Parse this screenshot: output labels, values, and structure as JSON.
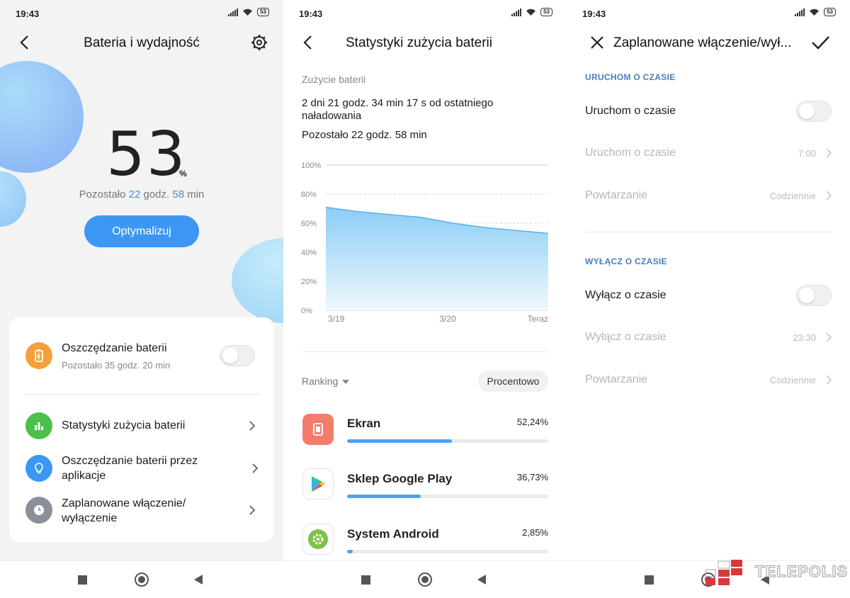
{
  "status": {
    "time": "19:43",
    "battery": "53"
  },
  "p1": {
    "title": "Bateria i wydajność",
    "percent": "53",
    "percent_sign": "%",
    "remaining_prefix": "Pozostało",
    "remaining_hours": "22",
    "remaining_hours_unit": "godz.",
    "remaining_minutes": "58",
    "remaining_minutes_unit": "min",
    "optimize_label": "Optymalizuj",
    "saver_title": "Oszczędzanie baterii",
    "saver_sub": "Pozostało 35 godz. 20 min",
    "stats_label": "Statystyki zużycia baterii",
    "apps_label_1": "Oszczędzanie baterii przez",
    "apps_label_2": "aplikacje",
    "sched_label_1": "Zaplanowane włączenie/",
    "sched_label_2": "wyłączenie",
    "colors": {
      "accent": "#3b97f2",
      "saver": "#f4a03a",
      "stats": "#4cc04a",
      "apps": "#3b97f2",
      "sched": "#8a8f9a"
    }
  },
  "p2": {
    "title": "Statystyki zużycia baterii",
    "usage_label": "Zużycie baterii",
    "since_1": "2 dni 21 godz. 34 min 17 s od ostatniego",
    "since_2": "naładowania",
    "remaining": "Pozostało 22 godz. 58 min",
    "ranking_label": "Ranking",
    "percent_pill": "Procentowo",
    "apps": [
      {
        "name": "Ekran",
        "percent_label": "52,24%",
        "fraction": 0.5224,
        "icon": "screen-icon"
      },
      {
        "name": "Sklep Google Play",
        "percent_label": "36,73%",
        "fraction": 0.3673,
        "icon": "play-store-icon"
      },
      {
        "name": "System Android",
        "percent_label": "2,85%",
        "fraction": 0.0285,
        "icon": "android-system-icon"
      }
    ]
  },
  "chart_data": {
    "type": "area",
    "x": [
      "3/19",
      "3/19",
      "3/19",
      "3/19",
      "3/20",
      "3/20",
      "3/20",
      "Teraz"
    ],
    "series": [
      {
        "values": [
          71,
          68,
          66,
          64,
          60,
          57,
          55,
          53
        ]
      }
    ],
    "y_tick_labels": [
      "100%",
      "80%",
      "60%",
      "40%",
      "20%",
      "0%"
    ],
    "x_tick_labels": [
      "3/19",
      "3/20",
      "Teraz"
    ],
    "ylim": [
      0,
      100
    ],
    "grid": true
  },
  "p3": {
    "title": "Zaplanowane włączenie/wył...",
    "section_on": "URUCHOM O CZASIE",
    "on_toggle_label": "Uruchom o czasie",
    "on_time_label": "Uruchom o czasie",
    "on_time_value": "7:00",
    "on_repeat_label": "Powtarzanie",
    "on_repeat_value": "Codziennie",
    "section_off": "WYŁĄCZ O CZASIE",
    "off_toggle_label": "Wyłącz o czasie",
    "off_time_label": "Wyłącz o czasie",
    "off_time_value": "23:30",
    "off_repeat_label": "Powtarzanie",
    "off_repeat_value": "Codziennie"
  },
  "watermark": "TELEPOLIS"
}
